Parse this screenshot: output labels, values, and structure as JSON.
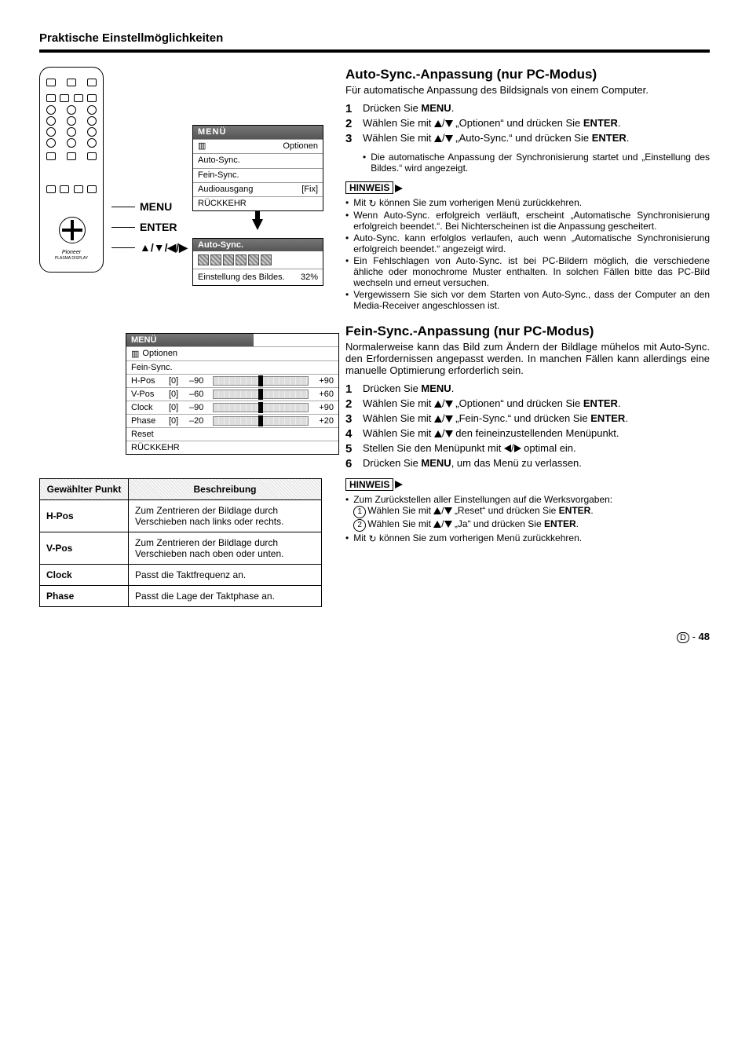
{
  "pageTitle": "Praktische Einstellmöglichkeiten",
  "remote": {
    "brand": "Pioneer",
    "sub": "PLASMA DISPLAY",
    "labels": {
      "menu": "MENU",
      "enter": "ENTER",
      "dpad": "▲/▼/◀/▶"
    }
  },
  "osd1": {
    "title": "MENÜ",
    "opt": "Optionen",
    "items": [
      "Auto-Sync.",
      "Fein-Sync.",
      "Audioausgang"
    ],
    "fixTag": "[Fix]",
    "back": "RÜCKKEHR"
  },
  "osd2": {
    "title": "Auto-Sync.",
    "status": "Einstellung des Bildes.",
    "percent": "32%"
  },
  "osd3": {
    "title": "MENÜ",
    "opt": "Optionen",
    "sub": "Fein-Sync.",
    "rows": [
      {
        "label": "H-Pos",
        "z": "[0]",
        "min": "–90",
        "max": "+90"
      },
      {
        "label": "V-Pos",
        "z": "[0]",
        "min": "–60",
        "max": "+60"
      },
      {
        "label": "Clock",
        "z": "[0]",
        "min": "–90",
        "max": "+90"
      },
      {
        "label": "Phase",
        "z": "[0]",
        "min": "–20",
        "max": "+20"
      }
    ],
    "reset": "Reset",
    "back": "RÜCKKEHR"
  },
  "descTable": {
    "h1": "Gewählter Punkt",
    "h2": "Beschreibung",
    "rows": [
      {
        "k": "H-Pos",
        "v": "Zum Zentrieren der Bildlage durch Verschieben nach links oder rechts."
      },
      {
        "k": "V-Pos",
        "v": "Zum Zentrieren der Bildlage durch Verschieben nach oben oder unten."
      },
      {
        "k": "Clock",
        "v": "Passt die Taktfrequenz an."
      },
      {
        "k": "Phase",
        "v": "Passt die Lage der Taktphase an."
      }
    ]
  },
  "auto": {
    "title": "Auto-Sync.-Anpassung (nur PC-Modus)",
    "intro": "Für automatische Anpassung des Bildsignals von einem Computer.",
    "s1a": "Drücken Sie ",
    "s1b": "MENU",
    "s1c": ".",
    "s2a": "Wählen Sie mit ",
    "s2b": " „Optionen“ und drücken Sie ",
    "s2c": "ENTER",
    "s2d": ".",
    "s3a": "Wählen Sie mit ",
    "s3b": " „Auto-Sync.“ und drücken Sie ",
    "s3c": "ENTER",
    "s3d": ".",
    "s3sub": "Die automatische Anpassung der Synchronisierung startet und „Einstellung des Bildes.“ wird angezeigt.",
    "hinweis": "HINWEIS",
    "n1a": "Mit ",
    "n1b": " können Sie zum vorherigen Menü zurückkehren.",
    "n2": "Wenn Auto-Sync. erfolgreich verläuft, erscheint „Automatische Synchronisierung erfolgreich beendet.“. Bei Nichterscheinen ist die Anpassung gescheitert.",
    "n3": "Auto-Sync. kann erfolglos verlaufen, auch wenn „Automatische Synchronisierung erfolgreich beendet.“ angezeigt wird.",
    "n4": "Ein Fehlschlagen von Auto-Sync. ist bei PC-Bildern möglich, die verschiedene ähliche oder monochrome Muster enthalten. In solchen Fällen bitte das PC-Bild wechseln und erneut versuchen.",
    "n5": "Vergewissern Sie sich vor dem Starten von Auto-Sync., dass der Computer an den Media-Receiver angeschlossen ist."
  },
  "fein": {
    "title": "Fein-Sync.-Anpassung (nur PC-Modus)",
    "intro": "Normalerweise kann das Bild zum Ändern der Bildlage mühelos mit Auto-Sync. den Erfordernissen angepasst werden. In manchen Fällen kann allerdings eine manuelle Optimierung erforderlich sein.",
    "s1a": "Drücken Sie ",
    "s1b": "MENU",
    "s1c": ".",
    "s2a": "Wählen Sie mit ",
    "s2b": " „Optionen“ und drücken Sie ",
    "s2c": "ENTER",
    "s2d": ".",
    "s3a": "Wählen Sie mit ",
    "s3b": " „Fein-Sync.“ und drücken Sie ",
    "s3c": "ENTER",
    "s3d": ".",
    "s4a": "Wählen Sie mit ",
    "s4b": " den feineinzustellenden Menüpunkt.",
    "s5a": "Stellen Sie den Menüpunkt mit ",
    "s5b": " optimal ein.",
    "s6a": "Drücken Sie ",
    "s6b": "MENU",
    "s6c": ", um das Menü zu verlassen.",
    "hinweis": "HINWEIS",
    "n1": "Zum Zurückstellen aller Einstellungen auf die Werksvorgaben:",
    "n1aA": "Wählen Sie mit ",
    "n1aB": " „Reset“ und drücken Sie ",
    "n1aC": "ENTER",
    "n1aD": ".",
    "n1bA": "Wählen Sie mit ",
    "n1bB": " „Ja“ und drücken Sie ",
    "n1bC": "ENTER",
    "n1bD": ".",
    "n2a": "Mit ",
    "n2b": " können Sie zum vorherigen Menü zurückkehren."
  },
  "pageNum": {
    "d": "D",
    "n": "48"
  }
}
